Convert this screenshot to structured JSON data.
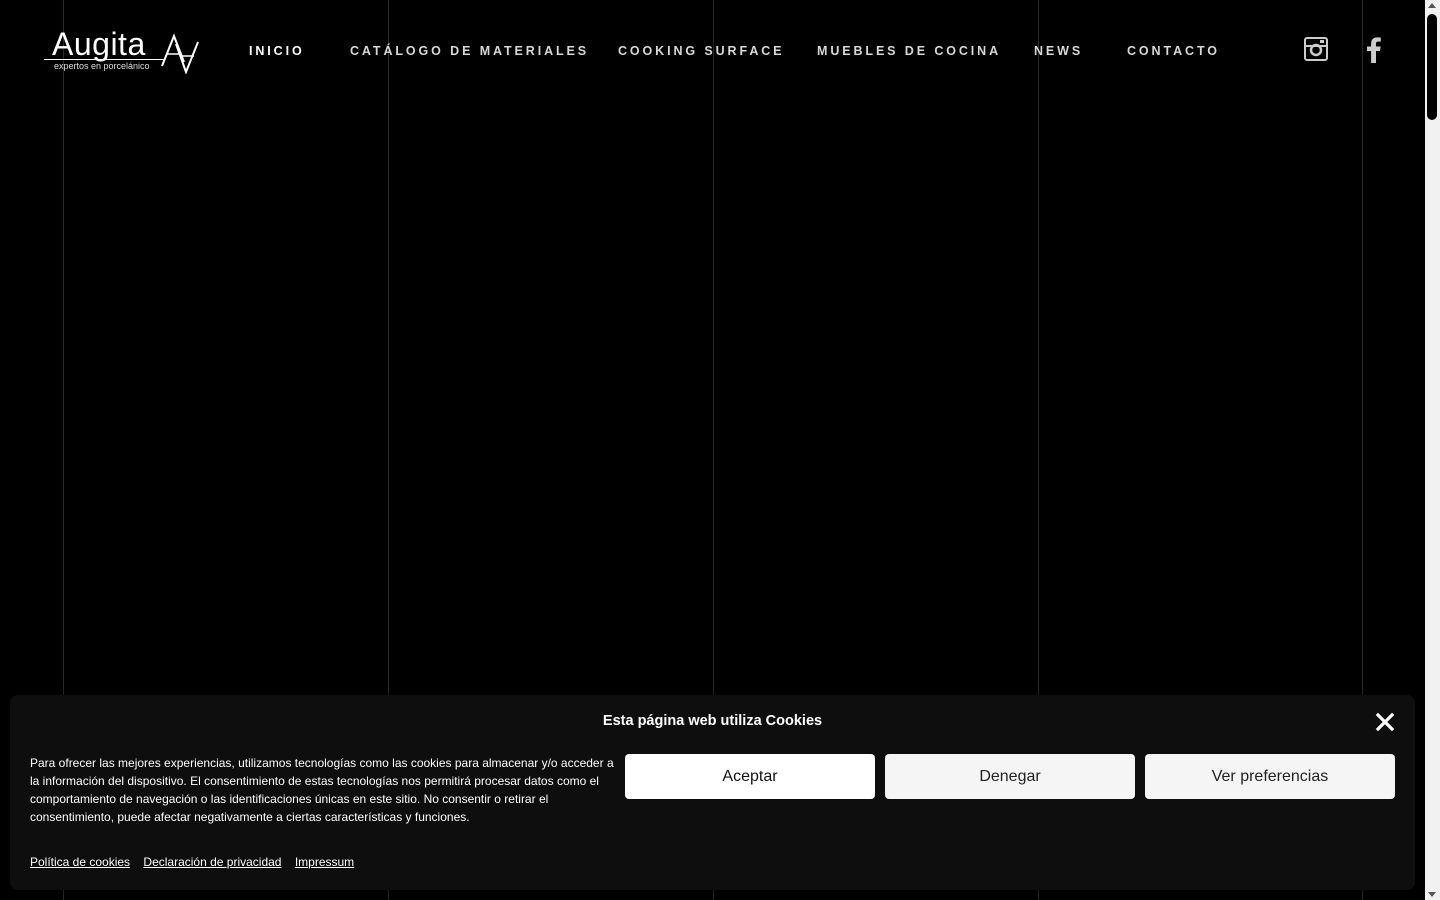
{
  "brand": {
    "name": "Augita",
    "tagline": "expertos en porcelánico",
    "logo_icon": "av-monogram-icon"
  },
  "nav": {
    "items": [
      {
        "label": "INICIO",
        "active": true
      },
      {
        "label": "CATÁLOGO DE MATERIALES",
        "active": false
      },
      {
        "label": "COOKING SURFACE",
        "active": false
      },
      {
        "label": "MUEBLES DE COCINA",
        "active": false
      },
      {
        "label": "NEWS",
        "active": false
      },
      {
        "label": "CONTACTO",
        "active": false
      }
    ]
  },
  "social": {
    "instagram_icon": "instagram-icon",
    "facebook_icon": "facebook-icon"
  },
  "cookie_banner": {
    "title": "Esta página web utiliza Cookies",
    "text": "Para ofrecer las mejores experiencias, utilizamos tecnologías como las cookies para almacenar y/o acceder a la información del dispositivo. El consentimiento de estas tecnologías nos permitirá procesar datos como el comportamiento de navegación o las identificaciones únicas en este sitio. No consentir o retirar el consentimiento, puede afectar negativamente a ciertas características y funciones.",
    "accept_label": "Aceptar",
    "deny_label": "Denegar",
    "preferences_label": "Ver preferencias",
    "links": [
      {
        "label": "Política de cookies"
      },
      {
        "label": "Declaración de privacidad"
      },
      {
        "label": "Impressum"
      }
    ],
    "close_icon": "close-icon"
  },
  "colors": {
    "background": "#000000",
    "banner_bg": "#0e0e0e",
    "text": "#ffffff"
  }
}
